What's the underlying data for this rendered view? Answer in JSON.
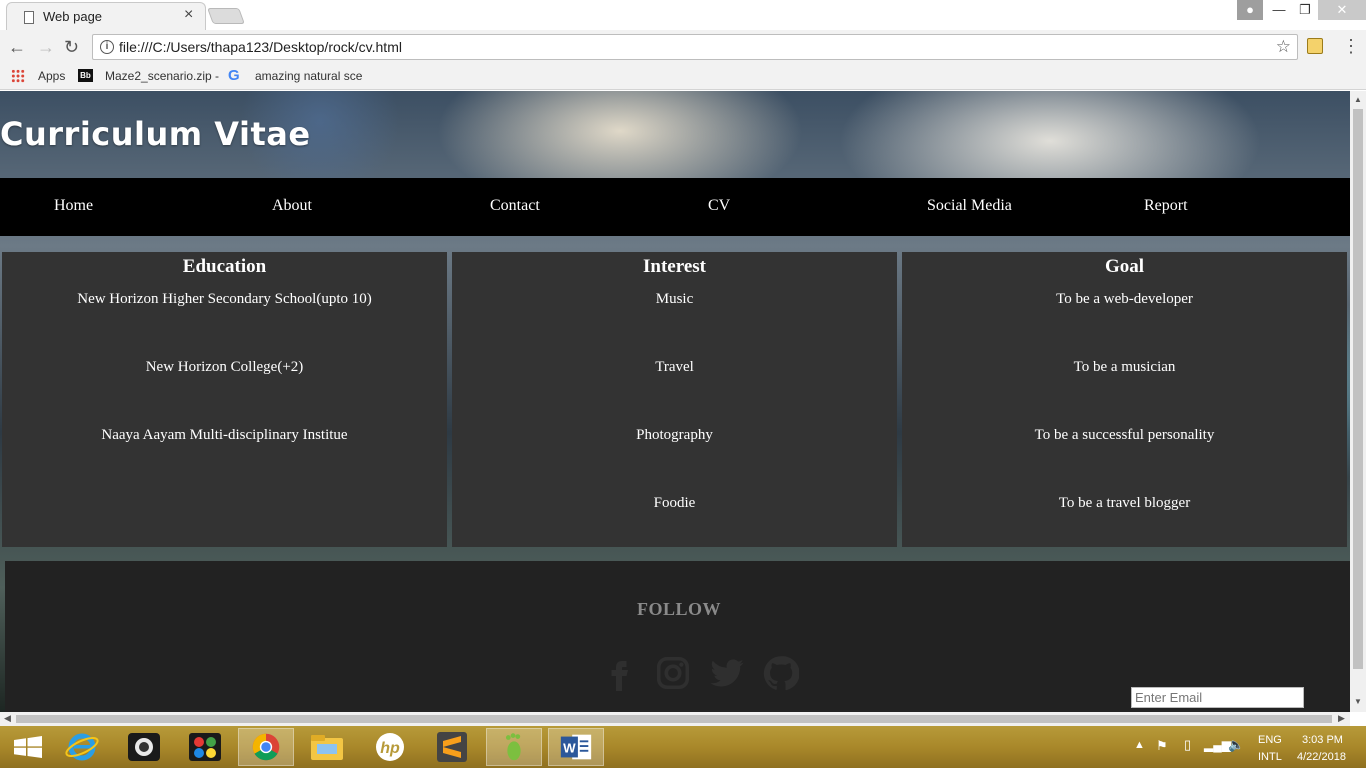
{
  "browser": {
    "tab_title": "Web page",
    "tab_close": "×",
    "url": "file:///C:/Users/thapa123/Desktop/rock/cv.html",
    "bookmarks": [
      {
        "label": "Apps",
        "icon": "apps-grid-icon"
      },
      {
        "label": "Maze2_scenario.zip -",
        "icon": "bb-icon"
      },
      {
        "label": "amazing natural sce",
        "icon": "google-icon"
      }
    ]
  },
  "page": {
    "title": "Curriculum Vitae",
    "nav": [
      "Home",
      "About",
      "Contact",
      "CV",
      "Social Media",
      "Report"
    ],
    "sections": [
      {
        "heading": "Education",
        "items": [
          "New Horizon Higher Secondary School(upto 10)",
          "New Horizon College(+2)",
          "Naaya Aayam Multi-disciplinary Institue"
        ]
      },
      {
        "heading": "Interest",
        "items": [
          "Music",
          "Travel",
          "Photography",
          "Foodie"
        ]
      },
      {
        "heading": "Goal",
        "items": [
          "To be a web-developer",
          "To be a musician",
          "To be a successful personality",
          "To be a travel blogger"
        ]
      }
    ],
    "footer": {
      "heading": "FOLLOW",
      "social_icons": [
        "facebook-icon",
        "instagram-icon",
        "twitter-icon",
        "github-icon"
      ],
      "email_placeholder": "Enter Email"
    }
  },
  "taskbar": {
    "apps": [
      "start-icon",
      "internet-explorer-icon",
      "camera-app-icon",
      "paint-app-icon",
      "chrome-icon",
      "file-explorer-icon",
      "hp-icon",
      "sublime-text-icon",
      "footprint-app-icon",
      "word-icon"
    ],
    "language": "ENG",
    "layout": "INTL",
    "time": "3:03 PM",
    "date": "4/22/2018"
  },
  "colors": {
    "navbar_bg": "#000000",
    "panel_bg": "#333333",
    "footer_bg": "#222222",
    "taskbar_bg": "#a9882a"
  }
}
